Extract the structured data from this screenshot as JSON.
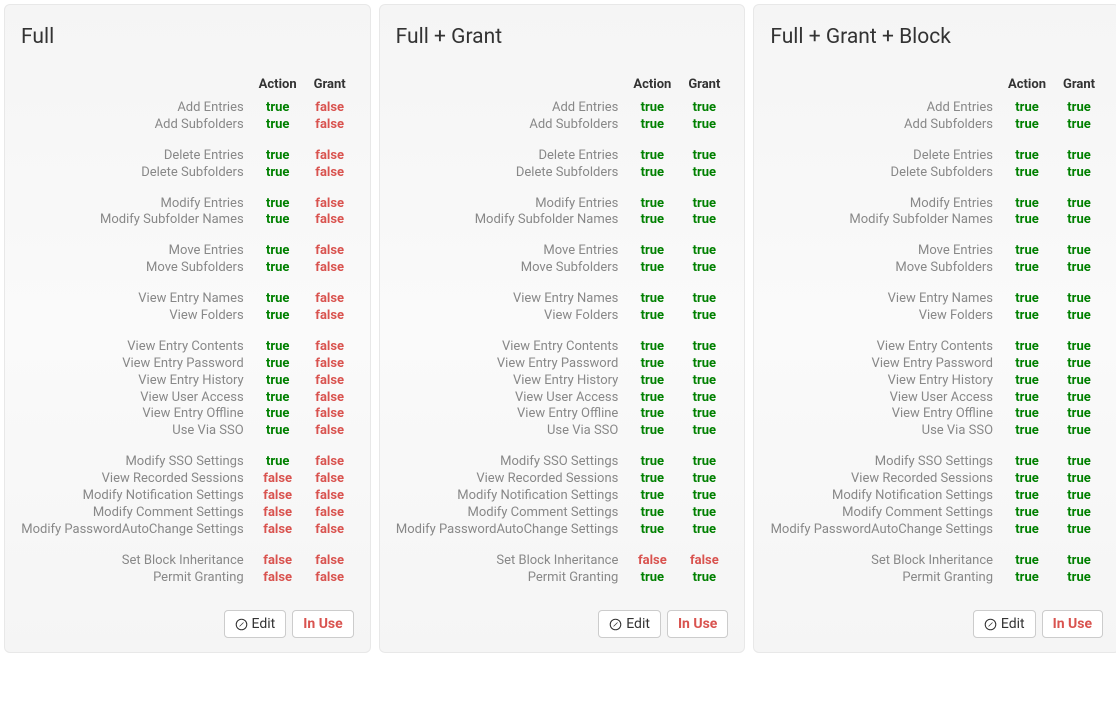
{
  "headers": {
    "action": "Action",
    "grant": "Grant"
  },
  "buttons": {
    "edit": "Edit",
    "inuse": "In Use"
  },
  "bool": {
    "true": "true",
    "false": "false"
  },
  "cards": [
    {
      "title": "Full",
      "groups": [
        [
          {
            "label": "Add Entries",
            "action": true,
            "grant": false
          },
          {
            "label": "Add Subfolders",
            "action": true,
            "grant": false
          }
        ],
        [
          {
            "label": "Delete Entries",
            "action": true,
            "grant": false
          },
          {
            "label": "Delete Subfolders",
            "action": true,
            "grant": false
          }
        ],
        [
          {
            "label": "Modify Entries",
            "action": true,
            "grant": false
          },
          {
            "label": "Modify Subfolder Names",
            "action": true,
            "grant": false
          }
        ],
        [
          {
            "label": "Move Entries",
            "action": true,
            "grant": false
          },
          {
            "label": "Move Subfolders",
            "action": true,
            "grant": false
          }
        ],
        [
          {
            "label": "View Entry Names",
            "action": true,
            "grant": false
          },
          {
            "label": "View Folders",
            "action": true,
            "grant": false
          }
        ],
        [
          {
            "label": "View Entry Contents",
            "action": true,
            "grant": false
          },
          {
            "label": "View Entry Password",
            "action": true,
            "grant": false
          },
          {
            "label": "View Entry History",
            "action": true,
            "grant": false
          },
          {
            "label": "View User Access",
            "action": true,
            "grant": false
          },
          {
            "label": "View Entry Offline",
            "action": true,
            "grant": false
          },
          {
            "label": "Use Via SSO",
            "action": true,
            "grant": false
          }
        ],
        [
          {
            "label": "Modify SSO Settings",
            "action": true,
            "grant": false
          },
          {
            "label": "View Recorded Sessions",
            "action": false,
            "grant": false
          },
          {
            "label": "Modify Notification Settings",
            "action": false,
            "grant": false
          },
          {
            "label": "Modify Comment Settings",
            "action": false,
            "grant": false
          },
          {
            "label": "Modify PasswordAutoChange Settings",
            "action": false,
            "grant": false
          }
        ],
        [
          {
            "label": "Set Block Inheritance",
            "action": false,
            "grant": false
          },
          {
            "label": "Permit Granting",
            "action": false,
            "grant": false
          }
        ]
      ]
    },
    {
      "title": "Full + Grant",
      "groups": [
        [
          {
            "label": "Add Entries",
            "action": true,
            "grant": true
          },
          {
            "label": "Add Subfolders",
            "action": true,
            "grant": true
          }
        ],
        [
          {
            "label": "Delete Entries",
            "action": true,
            "grant": true
          },
          {
            "label": "Delete Subfolders",
            "action": true,
            "grant": true
          }
        ],
        [
          {
            "label": "Modify Entries",
            "action": true,
            "grant": true
          },
          {
            "label": "Modify Subfolder Names",
            "action": true,
            "grant": true
          }
        ],
        [
          {
            "label": "Move Entries",
            "action": true,
            "grant": true
          },
          {
            "label": "Move Subfolders",
            "action": true,
            "grant": true
          }
        ],
        [
          {
            "label": "View Entry Names",
            "action": true,
            "grant": true
          },
          {
            "label": "View Folders",
            "action": true,
            "grant": true
          }
        ],
        [
          {
            "label": "View Entry Contents",
            "action": true,
            "grant": true
          },
          {
            "label": "View Entry Password",
            "action": true,
            "grant": true
          },
          {
            "label": "View Entry History",
            "action": true,
            "grant": true
          },
          {
            "label": "View User Access",
            "action": true,
            "grant": true
          },
          {
            "label": "View Entry Offline",
            "action": true,
            "grant": true
          },
          {
            "label": "Use Via SSO",
            "action": true,
            "grant": true
          }
        ],
        [
          {
            "label": "Modify SSO Settings",
            "action": true,
            "grant": true
          },
          {
            "label": "View Recorded Sessions",
            "action": true,
            "grant": true
          },
          {
            "label": "Modify Notification Settings",
            "action": true,
            "grant": true
          },
          {
            "label": "Modify Comment Settings",
            "action": true,
            "grant": true
          },
          {
            "label": "Modify PasswordAutoChange Settings",
            "action": true,
            "grant": true
          }
        ],
        [
          {
            "label": "Set Block Inheritance",
            "action": false,
            "grant": false
          },
          {
            "label": "Permit Granting",
            "action": true,
            "grant": true
          }
        ]
      ]
    },
    {
      "title": "Full + Grant + Block",
      "groups": [
        [
          {
            "label": "Add Entries",
            "action": true,
            "grant": true
          },
          {
            "label": "Add Subfolders",
            "action": true,
            "grant": true
          }
        ],
        [
          {
            "label": "Delete Entries",
            "action": true,
            "grant": true
          },
          {
            "label": "Delete Subfolders",
            "action": true,
            "grant": true
          }
        ],
        [
          {
            "label": "Modify Entries",
            "action": true,
            "grant": true
          },
          {
            "label": "Modify Subfolder Names",
            "action": true,
            "grant": true
          }
        ],
        [
          {
            "label": "Move Entries",
            "action": true,
            "grant": true
          },
          {
            "label": "Move Subfolders",
            "action": true,
            "grant": true
          }
        ],
        [
          {
            "label": "View Entry Names",
            "action": true,
            "grant": true
          },
          {
            "label": "View Folders",
            "action": true,
            "grant": true
          }
        ],
        [
          {
            "label": "View Entry Contents",
            "action": true,
            "grant": true
          },
          {
            "label": "View Entry Password",
            "action": true,
            "grant": true
          },
          {
            "label": "View Entry History",
            "action": true,
            "grant": true
          },
          {
            "label": "View User Access",
            "action": true,
            "grant": true
          },
          {
            "label": "View Entry Offline",
            "action": true,
            "grant": true
          },
          {
            "label": "Use Via SSO",
            "action": true,
            "grant": true
          }
        ],
        [
          {
            "label": "Modify SSO Settings",
            "action": true,
            "grant": true
          },
          {
            "label": "View Recorded Sessions",
            "action": true,
            "grant": true
          },
          {
            "label": "Modify Notification Settings",
            "action": true,
            "grant": true
          },
          {
            "label": "Modify Comment Settings",
            "action": true,
            "grant": true
          },
          {
            "label": "Modify PasswordAutoChange Settings",
            "action": true,
            "grant": true
          }
        ],
        [
          {
            "label": "Set Block Inheritance",
            "action": true,
            "grant": true
          },
          {
            "label": "Permit Granting",
            "action": true,
            "grant": true
          }
        ]
      ]
    }
  ]
}
